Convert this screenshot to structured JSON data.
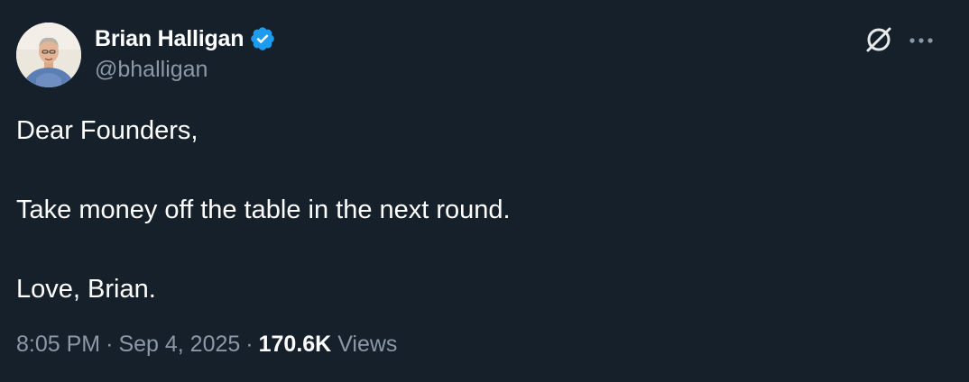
{
  "author": {
    "name": "Brian Halligan",
    "handle": "@bhalligan",
    "verified": true,
    "verified_color": "#1d9bf0"
  },
  "actions": {
    "grok_icon": "grok-icon",
    "more_icon": "more-options-icon"
  },
  "tweet": {
    "lines": [
      "Dear Founders,",
      "",
      "Take money off the table in the next round.",
      "",
      "Love, Brian."
    ]
  },
  "meta": {
    "time": "8:05 PM",
    "separator": "·",
    "date": "Sep 4, 2025",
    "views_count": "170.6K",
    "views_label": "Views"
  },
  "colors": {
    "background": "#16202b",
    "text": "#ffffff",
    "secondary_text": "#8b98a5",
    "accent": "#1d9bf0"
  }
}
